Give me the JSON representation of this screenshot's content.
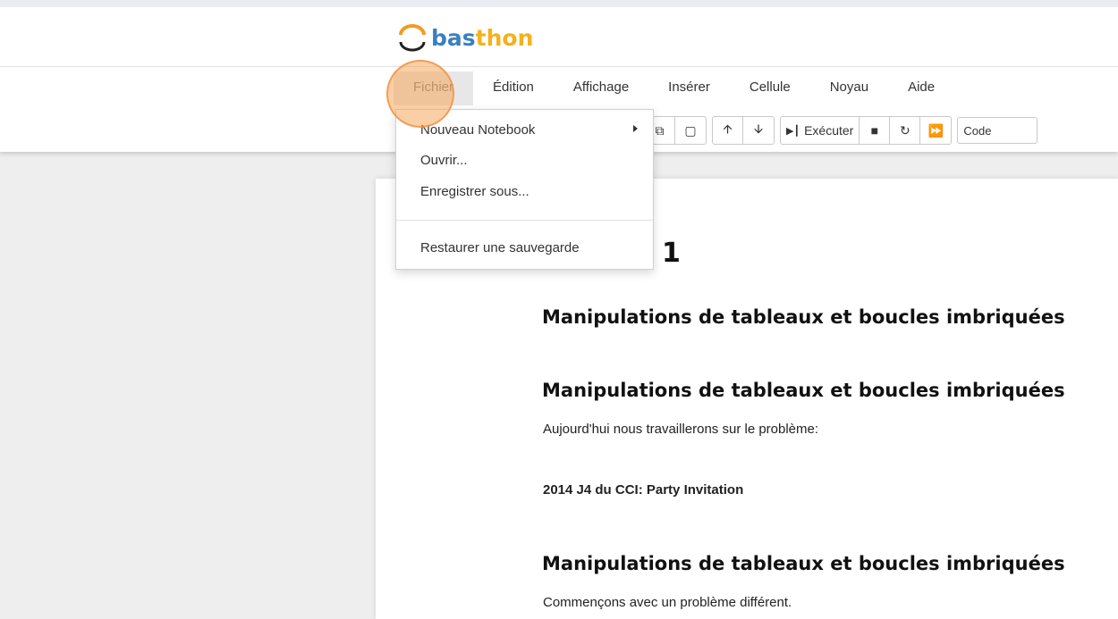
{
  "logo": {
    "part1": "bas",
    "part2": "thon"
  },
  "menu": [
    "Fichier",
    "Édition",
    "Affichage",
    "Insérer",
    "Cellule",
    "Noyau",
    "Aide"
  ],
  "toolbar": {
    "copy_icon": "copy-icon",
    "paste_icon": "paste-icon",
    "up_icon": "arrow-up-icon",
    "down_icon": "arrow-down-icon",
    "run_label": "Exécuter",
    "stop_icon": "stop-icon",
    "restart_icon": "restart-icon",
    "run_all_icon": "fast-forward-icon",
    "cell_type": "Code"
  },
  "dropdown": {
    "items": [
      "Nouveau Notebook",
      "Ouvrir...",
      "Enregistrer sous...",
      "Restaurer une sauvegarde"
    ]
  },
  "notebook": {
    "partial_heading": "1",
    "heading1": "Manipulations de tableaux et boucles imbriquées",
    "heading2": "Manipulations de tableaux et boucles imbriquées",
    "intro": "Aujourd'hui nous travaillerons sur le problème:",
    "problem": "2014 J4 du CCI: Party Invitation",
    "heading3": "Manipulations de tableaux et boucles imbriquées",
    "footer_text": "Commençons avec un problème différent."
  },
  "colors": {
    "accent_blue": "#3a7fc1",
    "accent_yellow": "#f3b11c",
    "click_indicator": "#f6a85c"
  }
}
